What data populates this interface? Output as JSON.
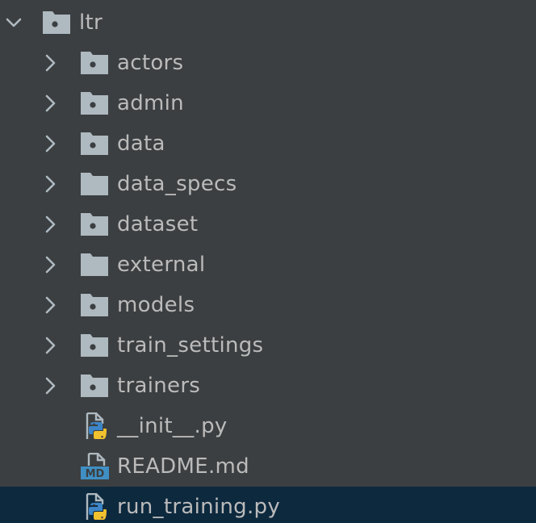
{
  "root": {
    "label": "ltr",
    "expanded": true,
    "icon": "package-folder-icon"
  },
  "items": [
    {
      "label": "actors",
      "type": "package-folder"
    },
    {
      "label": "admin",
      "type": "package-folder"
    },
    {
      "label": "data",
      "type": "package-folder"
    },
    {
      "label": "data_specs",
      "type": "folder"
    },
    {
      "label": "dataset",
      "type": "package-folder"
    },
    {
      "label": "external",
      "type": "folder"
    },
    {
      "label": "models",
      "type": "package-folder"
    },
    {
      "label": "train_settings",
      "type": "package-folder"
    },
    {
      "label": "trainers",
      "type": "package-folder"
    },
    {
      "label": "__init__.py",
      "type": "python-file"
    },
    {
      "label": "README.md",
      "type": "markdown-file",
      "icon_text": "MD"
    },
    {
      "label": "run_training.py",
      "type": "python-file",
      "selected": true
    }
  ],
  "colors": {
    "background": "#3c3f41",
    "text": "#bbbbbb",
    "folder": "#aeb9c0",
    "selection": "#0d293e",
    "python_blue": "#3d85c6",
    "python_yellow": "#f2c12e",
    "md_blue": "#3f8fc4"
  }
}
